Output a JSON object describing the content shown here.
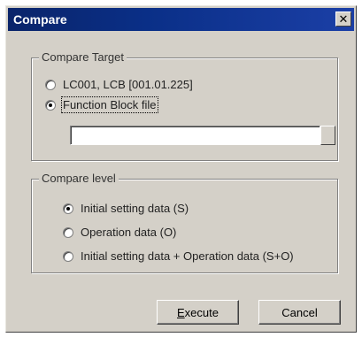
{
  "window": {
    "title": "Compare",
    "close_glyph": "✕"
  },
  "compare_target": {
    "legend": "Compare Target",
    "option_lc": "LC001, LCB  [001.01.225]",
    "option_fb": "Function Block file",
    "selected": "function_block",
    "file_value": "",
    "file_placeholder": ""
  },
  "compare_level": {
    "legend": "Compare level",
    "options": [
      "Initial setting data (S)",
      "Operation data (O)",
      "Initial setting data + Operation data (S+O)"
    ],
    "selected_index": 0
  },
  "buttons": {
    "execute_mnemonic": "E",
    "execute_rest": "xecute",
    "cancel": "Cancel"
  }
}
